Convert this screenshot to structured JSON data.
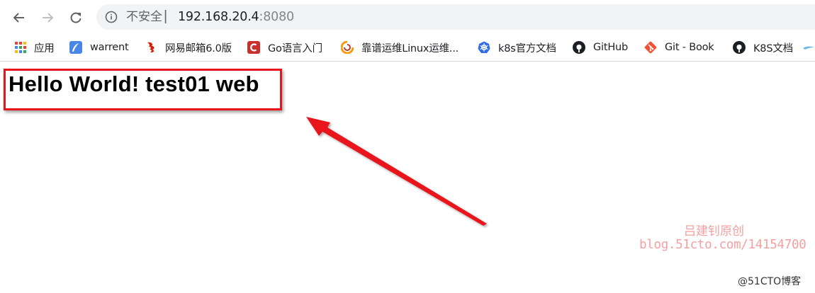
{
  "toolbar": {
    "security_label": "不安全",
    "separator": "|",
    "url_host": "192.168.20.4",
    "url_port": ":8080",
    "icons": [
      "back-arrow-icon",
      "forward-arrow-icon",
      "reload-icon",
      "info-icon"
    ]
  },
  "bookmarks": {
    "items": [
      {
        "label": "应用",
        "icon": "apps-grid-icon"
      },
      {
        "label": "warrent",
        "icon": "feather-icon"
      },
      {
        "label": "网易邮箱6.0版",
        "icon": "netease-mail-icon"
      },
      {
        "label": "Go语言入门",
        "icon": "c-logo-icon"
      },
      {
        "label": "靠谱运维Linux运维...",
        "icon": "swirl-logo-icon"
      },
      {
        "label": "k8s官方文档",
        "icon": "kubernetes-icon"
      },
      {
        "label": "GitHub",
        "icon": "github-icon"
      },
      {
        "label": "Git - Book",
        "icon": "git-icon"
      },
      {
        "label": "K8S文档",
        "icon": "github-icon"
      }
    ]
  },
  "page": {
    "heading": "Hello World! test01 web"
  },
  "annotations": {
    "highlight_color": "#e8141a"
  },
  "watermark": {
    "author": "吕建钊原创",
    "blog": "blog.51cto.com/14154700",
    "site": "@51CTO博客"
  }
}
